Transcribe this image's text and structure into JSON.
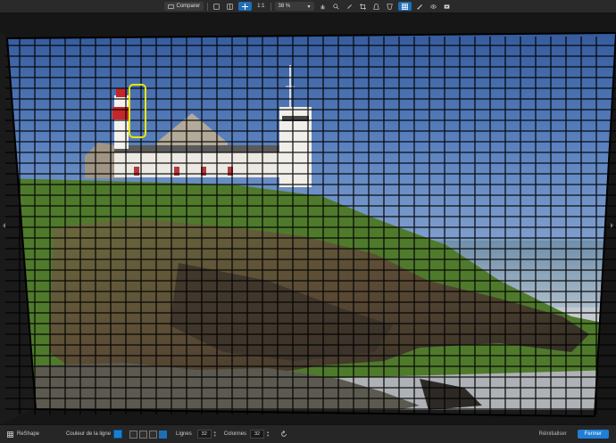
{
  "toolbar": {
    "compare_label": "Comparer",
    "zoom_11": "1:1",
    "zoom_level": "38 %",
    "icons": [
      "compare-icon",
      "single-view-icon",
      "split-view-icon",
      "move-icon",
      "hand-icon",
      "zoom-icon",
      "eyedropper-icon",
      "crop-icon",
      "perspective-icon",
      "reshape-grid-icon",
      "brush-icon",
      "eye-icon",
      "overlay-icon"
    ]
  },
  "bottom": {
    "tool_name": "ReShape",
    "line_color_label": "Couleur de la ligne",
    "line_color": "#1a7fd4",
    "rows_label": "Lignes",
    "rows_value": "32",
    "cols_label": "Colonnes",
    "cols_value": "32",
    "reset_label": "Réinitialiser",
    "close_label": "Fermer"
  },
  "colors": {
    "accent": "#1f7fd6",
    "highlight": "#e6e600",
    "grid": "#000000"
  }
}
